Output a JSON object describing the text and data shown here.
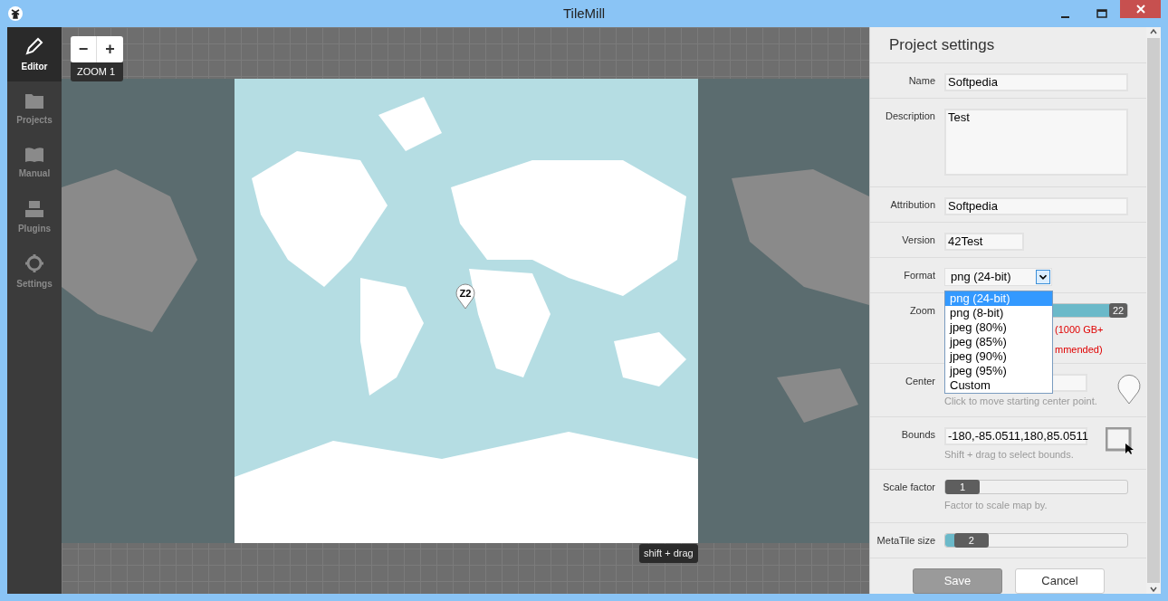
{
  "window": {
    "title": "TileMill"
  },
  "sidebar": {
    "items": [
      {
        "label": "Editor",
        "selected": true
      },
      {
        "label": "Projects",
        "selected": false
      },
      {
        "label": "Manual",
        "selected": false
      },
      {
        "label": "Plugins",
        "selected": false
      },
      {
        "label": "Settings",
        "selected": false
      }
    ]
  },
  "map": {
    "zoom_out": "−",
    "zoom_in": "+",
    "zoom_label": "ZOOM 1",
    "marker": "Z2",
    "hint": "shift + drag"
  },
  "panel": {
    "title": "Project settings",
    "fields": [
      {
        "kind": "text",
        "label": "Name",
        "value": "Softpedia"
      },
      {
        "kind": "textarea",
        "label": "Description",
        "value": "Test"
      },
      {
        "kind": "text",
        "label": "Attribution",
        "value": "Softpedia"
      },
      {
        "kind": "short",
        "label": "Version",
        "value": "42Test"
      },
      {
        "kind": "select",
        "label": "Format",
        "value": "png (24-bit)",
        "expanded": true,
        "options": [
          {
            "label": "png (24-bit)",
            "selected": true
          },
          {
            "label": "png (8-bit)",
            "selected": false
          },
          {
            "label": "jpeg (80%)",
            "selected": false
          },
          {
            "label": "jpeg (85%)",
            "selected": false
          },
          {
            "label": "jpeg (90%)",
            "selected": false
          },
          {
            "label": "jpeg (95%)",
            "selected": false
          },
          {
            "label": "Custom",
            "selected": false
          }
        ]
      },
      {
        "kind": "range",
        "label": "Zoom",
        "handle": "22",
        "warning": [
          "(1000 GB+",
          "mmended)"
        ]
      },
      {
        "kind": "point",
        "label": "Center",
        "hint": "Click to move starting center point."
      },
      {
        "kind": "bounds",
        "label": "Bounds",
        "value": "-180,-85.0511,180,85.0511",
        "hint": "Shift + drag to select bounds."
      },
      {
        "kind": "slider",
        "label": "Scale factor",
        "handle": "1",
        "level": 0,
        "hint": "Factor to scale map by."
      },
      {
        "kind": "slider",
        "label": "MetaTile size",
        "handle": "2",
        "level": 0.06
      }
    ],
    "buttons": [
      {
        "label": "Save",
        "kind": "primary"
      },
      {
        "label": "Cancel",
        "kind": "secondary"
      }
    ]
  }
}
